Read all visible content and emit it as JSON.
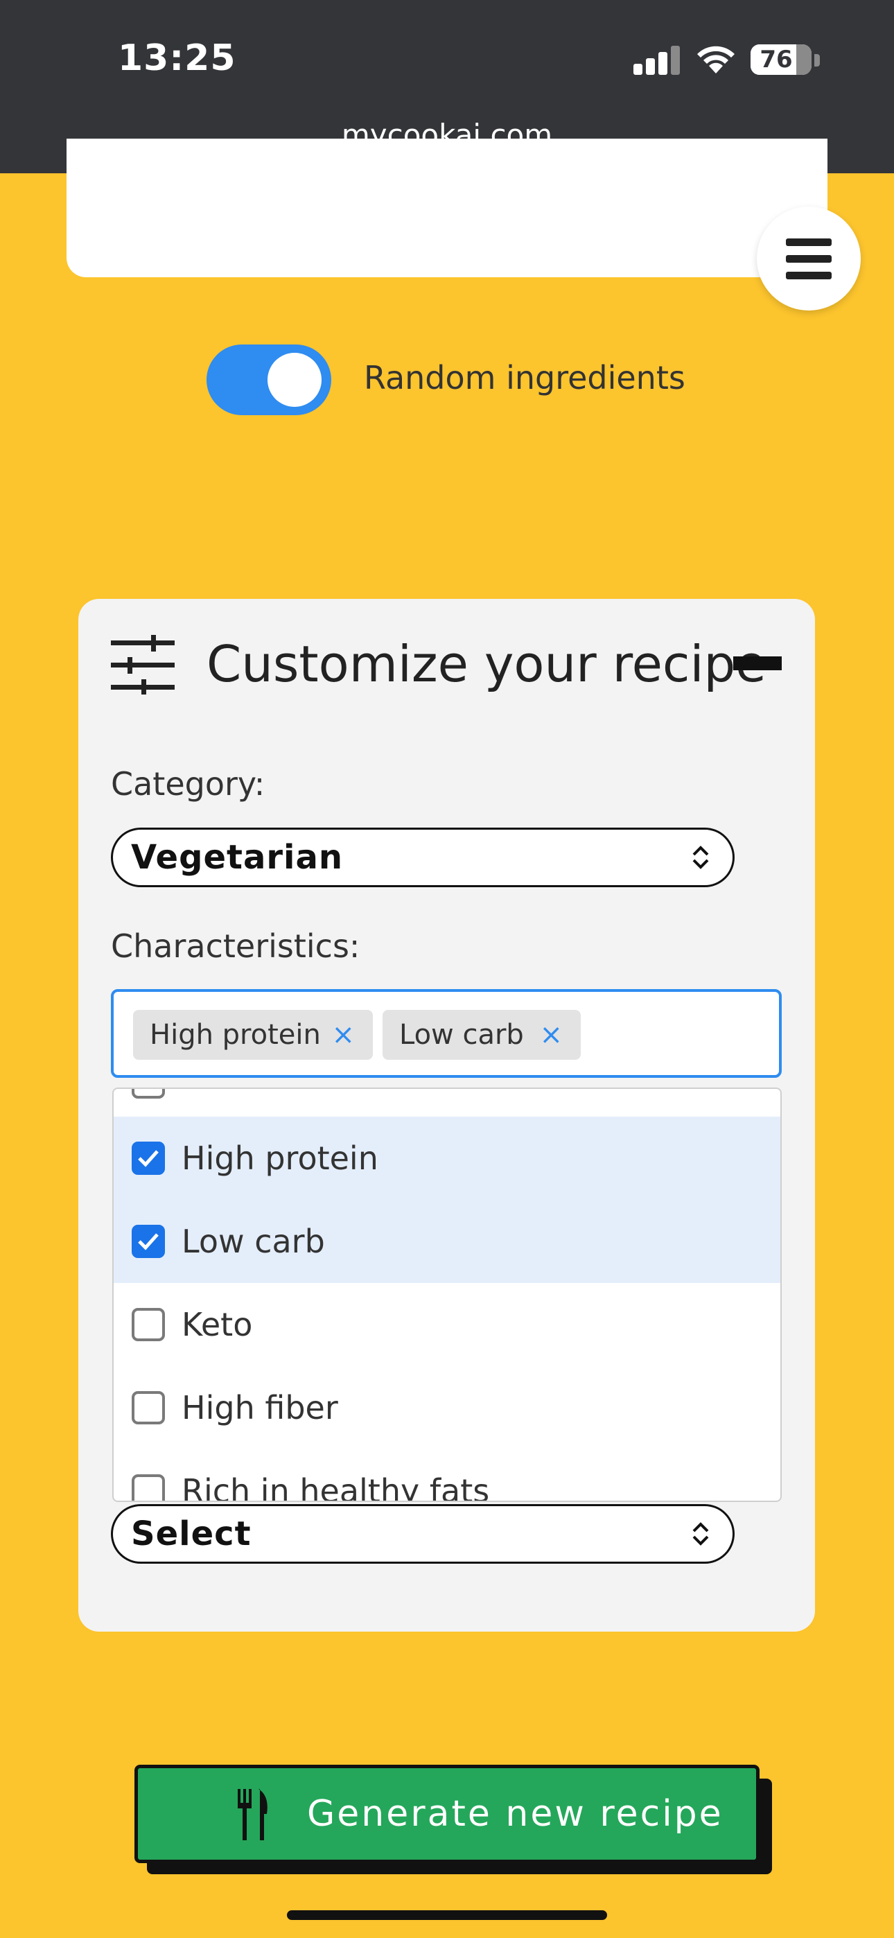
{
  "status_bar": {
    "time": "13:25",
    "battery": "76",
    "url": "mycookai.com"
  },
  "icons": {
    "menu": "hamburger-menu-icon",
    "customize": "sliders-icon",
    "collapse": "minus-icon",
    "select": "chevron-up-down-icon",
    "remove_tag": "close-icon",
    "generate": "fork-knife-icon"
  },
  "toggle": {
    "label": "Random ingredients",
    "on": true
  },
  "customize": {
    "title": "Customize your recipe",
    "category": {
      "label": "Category:",
      "value": "Vegetarian"
    },
    "characteristics": {
      "label": "Characteristics:",
      "tags": [
        {
          "label": "High protein",
          "remove": "×"
        },
        {
          "label": "Low carb",
          "remove": "×"
        }
      ],
      "options": [
        {
          "label": "High protein",
          "checked": true
        },
        {
          "label": "Low carb",
          "checked": true
        },
        {
          "label": "Keto",
          "checked": false
        },
        {
          "label": "High fiber",
          "checked": false
        },
        {
          "label": "Rich in healthy fats",
          "checked": false
        }
      ]
    },
    "third_select": {
      "value": "Select"
    }
  },
  "generate_button": {
    "label": "Generate new recipe"
  },
  "colors": {
    "background": "#FCC42D",
    "accent_blue": "#2F8CF0",
    "checkbox_blue": "#1A73E8",
    "generate_green": "#24A75A",
    "status_bar": "#333538"
  }
}
